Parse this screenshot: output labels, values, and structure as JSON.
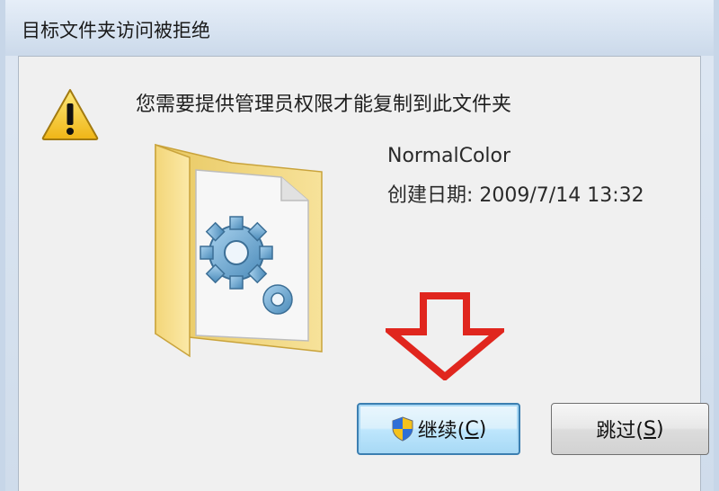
{
  "window": {
    "title": "目标文件夹访问被拒绝"
  },
  "dialog": {
    "message": "您需要提供管理员权限才能复制到此文件夹",
    "icon": "warning-icon",
    "item": {
      "icon": "folder-gears-icon",
      "name": "NormalColor",
      "created_label": "创建日期: 2009/7/14 13:32"
    },
    "annotation": {
      "icon": "red-down-arrow",
      "color": "#e0261e"
    }
  },
  "buttons": {
    "continue": {
      "label_prefix": "继续(",
      "accel": "C",
      "label_suffix": ")",
      "icon": "uac-shield-icon"
    },
    "skip": {
      "label_prefix": "跳过(",
      "accel": "S",
      "label_suffix": ")"
    }
  },
  "colors": {
    "focus_border": "#3c7fb1",
    "client_bg": "#f0f0f0"
  }
}
